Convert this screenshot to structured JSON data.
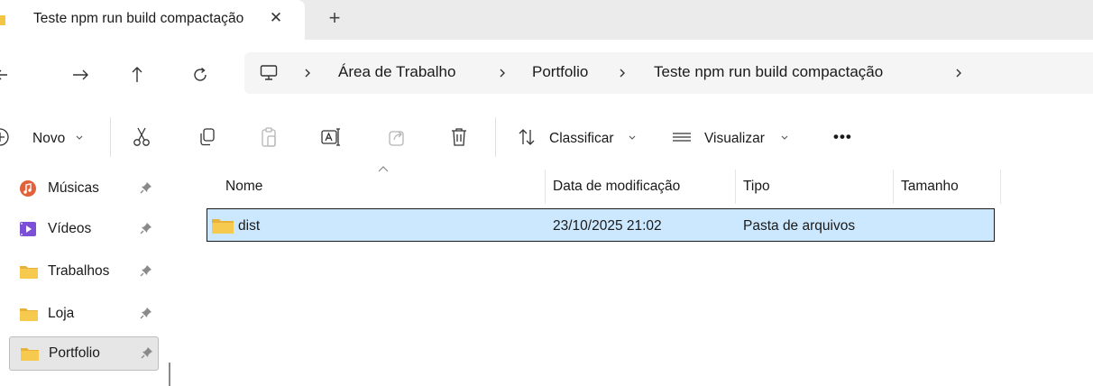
{
  "tab": {
    "title": "Teste npm run build compactação",
    "close_glyph": "✕",
    "new_tab_glyph": "+"
  },
  "breadcrumb": [
    "Área de Trabalho",
    "Portfolio",
    "Teste npm run build compactação"
  ],
  "commands": {
    "new": "Novo",
    "sort": "Classificar",
    "view": "Visualizar",
    "more": "•••"
  },
  "sidebar": {
    "items": [
      {
        "label": "Músicas",
        "icon": "music-icon"
      },
      {
        "label": "Vídeos",
        "icon": "videos-icon"
      },
      {
        "label": "Trabalhos",
        "icon": "folder-icon"
      },
      {
        "label": "Loja",
        "icon": "folder-icon"
      },
      {
        "label": "Portfolio",
        "icon": "folder-icon",
        "selected": true
      }
    ]
  },
  "columns": {
    "name": "Nome",
    "modified": "Data de modificação",
    "type": "Tipo",
    "size": "Tamanho"
  },
  "files": [
    {
      "name": "dist",
      "modified": "23/10/2025 21:02",
      "type": "Pasta de arquivos",
      "size": "",
      "selected": true
    }
  ],
  "colors": {
    "folder": "#f4c542",
    "selection": "#cce8ff",
    "accent": "#0067c0"
  }
}
